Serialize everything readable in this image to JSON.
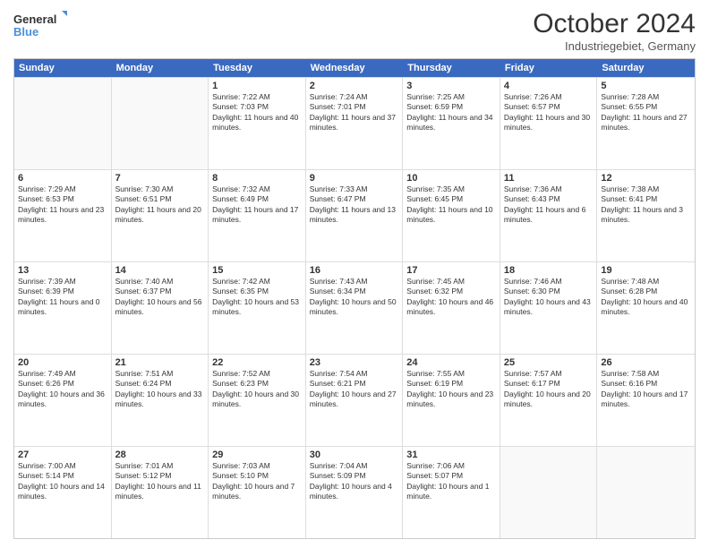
{
  "header": {
    "logo_line1": "General",
    "logo_line2": "Blue",
    "month": "October 2024",
    "location": "Industriegebiet, Germany"
  },
  "weekdays": [
    "Sunday",
    "Monday",
    "Tuesday",
    "Wednesday",
    "Thursday",
    "Friday",
    "Saturday"
  ],
  "rows": [
    [
      {
        "day": "",
        "info": ""
      },
      {
        "day": "",
        "info": ""
      },
      {
        "day": "1",
        "info": "Sunrise: 7:22 AM\nSunset: 7:03 PM\nDaylight: 11 hours and 40 minutes."
      },
      {
        "day": "2",
        "info": "Sunrise: 7:24 AM\nSunset: 7:01 PM\nDaylight: 11 hours and 37 minutes."
      },
      {
        "day": "3",
        "info": "Sunrise: 7:25 AM\nSunset: 6:59 PM\nDaylight: 11 hours and 34 minutes."
      },
      {
        "day": "4",
        "info": "Sunrise: 7:26 AM\nSunset: 6:57 PM\nDaylight: 11 hours and 30 minutes."
      },
      {
        "day": "5",
        "info": "Sunrise: 7:28 AM\nSunset: 6:55 PM\nDaylight: 11 hours and 27 minutes."
      }
    ],
    [
      {
        "day": "6",
        "info": "Sunrise: 7:29 AM\nSunset: 6:53 PM\nDaylight: 11 hours and 23 minutes."
      },
      {
        "day": "7",
        "info": "Sunrise: 7:30 AM\nSunset: 6:51 PM\nDaylight: 11 hours and 20 minutes."
      },
      {
        "day": "8",
        "info": "Sunrise: 7:32 AM\nSunset: 6:49 PM\nDaylight: 11 hours and 17 minutes."
      },
      {
        "day": "9",
        "info": "Sunrise: 7:33 AM\nSunset: 6:47 PM\nDaylight: 11 hours and 13 minutes."
      },
      {
        "day": "10",
        "info": "Sunrise: 7:35 AM\nSunset: 6:45 PM\nDaylight: 11 hours and 10 minutes."
      },
      {
        "day": "11",
        "info": "Sunrise: 7:36 AM\nSunset: 6:43 PM\nDaylight: 11 hours and 6 minutes."
      },
      {
        "day": "12",
        "info": "Sunrise: 7:38 AM\nSunset: 6:41 PM\nDaylight: 11 hours and 3 minutes."
      }
    ],
    [
      {
        "day": "13",
        "info": "Sunrise: 7:39 AM\nSunset: 6:39 PM\nDaylight: 11 hours and 0 minutes."
      },
      {
        "day": "14",
        "info": "Sunrise: 7:40 AM\nSunset: 6:37 PM\nDaylight: 10 hours and 56 minutes."
      },
      {
        "day": "15",
        "info": "Sunrise: 7:42 AM\nSunset: 6:35 PM\nDaylight: 10 hours and 53 minutes."
      },
      {
        "day": "16",
        "info": "Sunrise: 7:43 AM\nSunset: 6:34 PM\nDaylight: 10 hours and 50 minutes."
      },
      {
        "day": "17",
        "info": "Sunrise: 7:45 AM\nSunset: 6:32 PM\nDaylight: 10 hours and 46 minutes."
      },
      {
        "day": "18",
        "info": "Sunrise: 7:46 AM\nSunset: 6:30 PM\nDaylight: 10 hours and 43 minutes."
      },
      {
        "day": "19",
        "info": "Sunrise: 7:48 AM\nSunset: 6:28 PM\nDaylight: 10 hours and 40 minutes."
      }
    ],
    [
      {
        "day": "20",
        "info": "Sunrise: 7:49 AM\nSunset: 6:26 PM\nDaylight: 10 hours and 36 minutes."
      },
      {
        "day": "21",
        "info": "Sunrise: 7:51 AM\nSunset: 6:24 PM\nDaylight: 10 hours and 33 minutes."
      },
      {
        "day": "22",
        "info": "Sunrise: 7:52 AM\nSunset: 6:23 PM\nDaylight: 10 hours and 30 minutes."
      },
      {
        "day": "23",
        "info": "Sunrise: 7:54 AM\nSunset: 6:21 PM\nDaylight: 10 hours and 27 minutes."
      },
      {
        "day": "24",
        "info": "Sunrise: 7:55 AM\nSunset: 6:19 PM\nDaylight: 10 hours and 23 minutes."
      },
      {
        "day": "25",
        "info": "Sunrise: 7:57 AM\nSunset: 6:17 PM\nDaylight: 10 hours and 20 minutes."
      },
      {
        "day": "26",
        "info": "Sunrise: 7:58 AM\nSunset: 6:16 PM\nDaylight: 10 hours and 17 minutes."
      }
    ],
    [
      {
        "day": "27",
        "info": "Sunrise: 7:00 AM\nSunset: 5:14 PM\nDaylight: 10 hours and 14 minutes."
      },
      {
        "day": "28",
        "info": "Sunrise: 7:01 AM\nSunset: 5:12 PM\nDaylight: 10 hours and 11 minutes."
      },
      {
        "day": "29",
        "info": "Sunrise: 7:03 AM\nSunset: 5:10 PM\nDaylight: 10 hours and 7 minutes."
      },
      {
        "day": "30",
        "info": "Sunrise: 7:04 AM\nSunset: 5:09 PM\nDaylight: 10 hours and 4 minutes."
      },
      {
        "day": "31",
        "info": "Sunrise: 7:06 AM\nSunset: 5:07 PM\nDaylight: 10 hours and 1 minute."
      },
      {
        "day": "",
        "info": ""
      },
      {
        "day": "",
        "info": ""
      }
    ]
  ]
}
